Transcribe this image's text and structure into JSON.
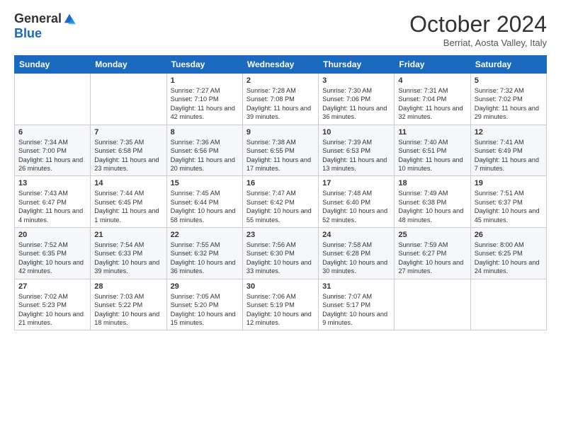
{
  "header": {
    "logo_general": "General",
    "logo_blue": "Blue",
    "month_title": "October 2024",
    "location": "Berriat, Aosta Valley, Italy"
  },
  "weekdays": [
    "Sunday",
    "Monday",
    "Tuesday",
    "Wednesday",
    "Thursday",
    "Friday",
    "Saturday"
  ],
  "weeks": [
    [
      {
        "day": "",
        "content": ""
      },
      {
        "day": "",
        "content": ""
      },
      {
        "day": "1",
        "content": "Sunrise: 7:27 AM\nSunset: 7:10 PM\nDaylight: 11 hours and 42 minutes."
      },
      {
        "day": "2",
        "content": "Sunrise: 7:28 AM\nSunset: 7:08 PM\nDaylight: 11 hours and 39 minutes."
      },
      {
        "day": "3",
        "content": "Sunrise: 7:30 AM\nSunset: 7:06 PM\nDaylight: 11 hours and 36 minutes."
      },
      {
        "day": "4",
        "content": "Sunrise: 7:31 AM\nSunset: 7:04 PM\nDaylight: 11 hours and 32 minutes."
      },
      {
        "day": "5",
        "content": "Sunrise: 7:32 AM\nSunset: 7:02 PM\nDaylight: 11 hours and 29 minutes."
      }
    ],
    [
      {
        "day": "6",
        "content": "Sunrise: 7:34 AM\nSunset: 7:00 PM\nDaylight: 11 hours and 26 minutes."
      },
      {
        "day": "7",
        "content": "Sunrise: 7:35 AM\nSunset: 6:58 PM\nDaylight: 11 hours and 23 minutes."
      },
      {
        "day": "8",
        "content": "Sunrise: 7:36 AM\nSunset: 6:56 PM\nDaylight: 11 hours and 20 minutes."
      },
      {
        "day": "9",
        "content": "Sunrise: 7:38 AM\nSunset: 6:55 PM\nDaylight: 11 hours and 17 minutes."
      },
      {
        "day": "10",
        "content": "Sunrise: 7:39 AM\nSunset: 6:53 PM\nDaylight: 11 hours and 13 minutes."
      },
      {
        "day": "11",
        "content": "Sunrise: 7:40 AM\nSunset: 6:51 PM\nDaylight: 11 hours and 10 minutes."
      },
      {
        "day": "12",
        "content": "Sunrise: 7:41 AM\nSunset: 6:49 PM\nDaylight: 11 hours and 7 minutes."
      }
    ],
    [
      {
        "day": "13",
        "content": "Sunrise: 7:43 AM\nSunset: 6:47 PM\nDaylight: 11 hours and 4 minutes."
      },
      {
        "day": "14",
        "content": "Sunrise: 7:44 AM\nSunset: 6:45 PM\nDaylight: 11 hours and 1 minute."
      },
      {
        "day": "15",
        "content": "Sunrise: 7:45 AM\nSunset: 6:44 PM\nDaylight: 10 hours and 58 minutes."
      },
      {
        "day": "16",
        "content": "Sunrise: 7:47 AM\nSunset: 6:42 PM\nDaylight: 10 hours and 55 minutes."
      },
      {
        "day": "17",
        "content": "Sunrise: 7:48 AM\nSunset: 6:40 PM\nDaylight: 10 hours and 52 minutes."
      },
      {
        "day": "18",
        "content": "Sunrise: 7:49 AM\nSunset: 6:38 PM\nDaylight: 10 hours and 48 minutes."
      },
      {
        "day": "19",
        "content": "Sunrise: 7:51 AM\nSunset: 6:37 PM\nDaylight: 10 hours and 45 minutes."
      }
    ],
    [
      {
        "day": "20",
        "content": "Sunrise: 7:52 AM\nSunset: 6:35 PM\nDaylight: 10 hours and 42 minutes."
      },
      {
        "day": "21",
        "content": "Sunrise: 7:54 AM\nSunset: 6:33 PM\nDaylight: 10 hours and 39 minutes."
      },
      {
        "day": "22",
        "content": "Sunrise: 7:55 AM\nSunset: 6:32 PM\nDaylight: 10 hours and 36 minutes."
      },
      {
        "day": "23",
        "content": "Sunrise: 7:56 AM\nSunset: 6:30 PM\nDaylight: 10 hours and 33 minutes."
      },
      {
        "day": "24",
        "content": "Sunrise: 7:58 AM\nSunset: 6:28 PM\nDaylight: 10 hours and 30 minutes."
      },
      {
        "day": "25",
        "content": "Sunrise: 7:59 AM\nSunset: 6:27 PM\nDaylight: 10 hours and 27 minutes."
      },
      {
        "day": "26",
        "content": "Sunrise: 8:00 AM\nSunset: 6:25 PM\nDaylight: 10 hours and 24 minutes."
      }
    ],
    [
      {
        "day": "27",
        "content": "Sunrise: 7:02 AM\nSunset: 5:23 PM\nDaylight: 10 hours and 21 minutes."
      },
      {
        "day": "28",
        "content": "Sunrise: 7:03 AM\nSunset: 5:22 PM\nDaylight: 10 hours and 18 minutes."
      },
      {
        "day": "29",
        "content": "Sunrise: 7:05 AM\nSunset: 5:20 PM\nDaylight: 10 hours and 15 minutes."
      },
      {
        "day": "30",
        "content": "Sunrise: 7:06 AM\nSunset: 5:19 PM\nDaylight: 10 hours and 12 minutes."
      },
      {
        "day": "31",
        "content": "Sunrise: 7:07 AM\nSunset: 5:17 PM\nDaylight: 10 hours and 9 minutes."
      },
      {
        "day": "",
        "content": ""
      },
      {
        "day": "",
        "content": ""
      }
    ]
  ]
}
